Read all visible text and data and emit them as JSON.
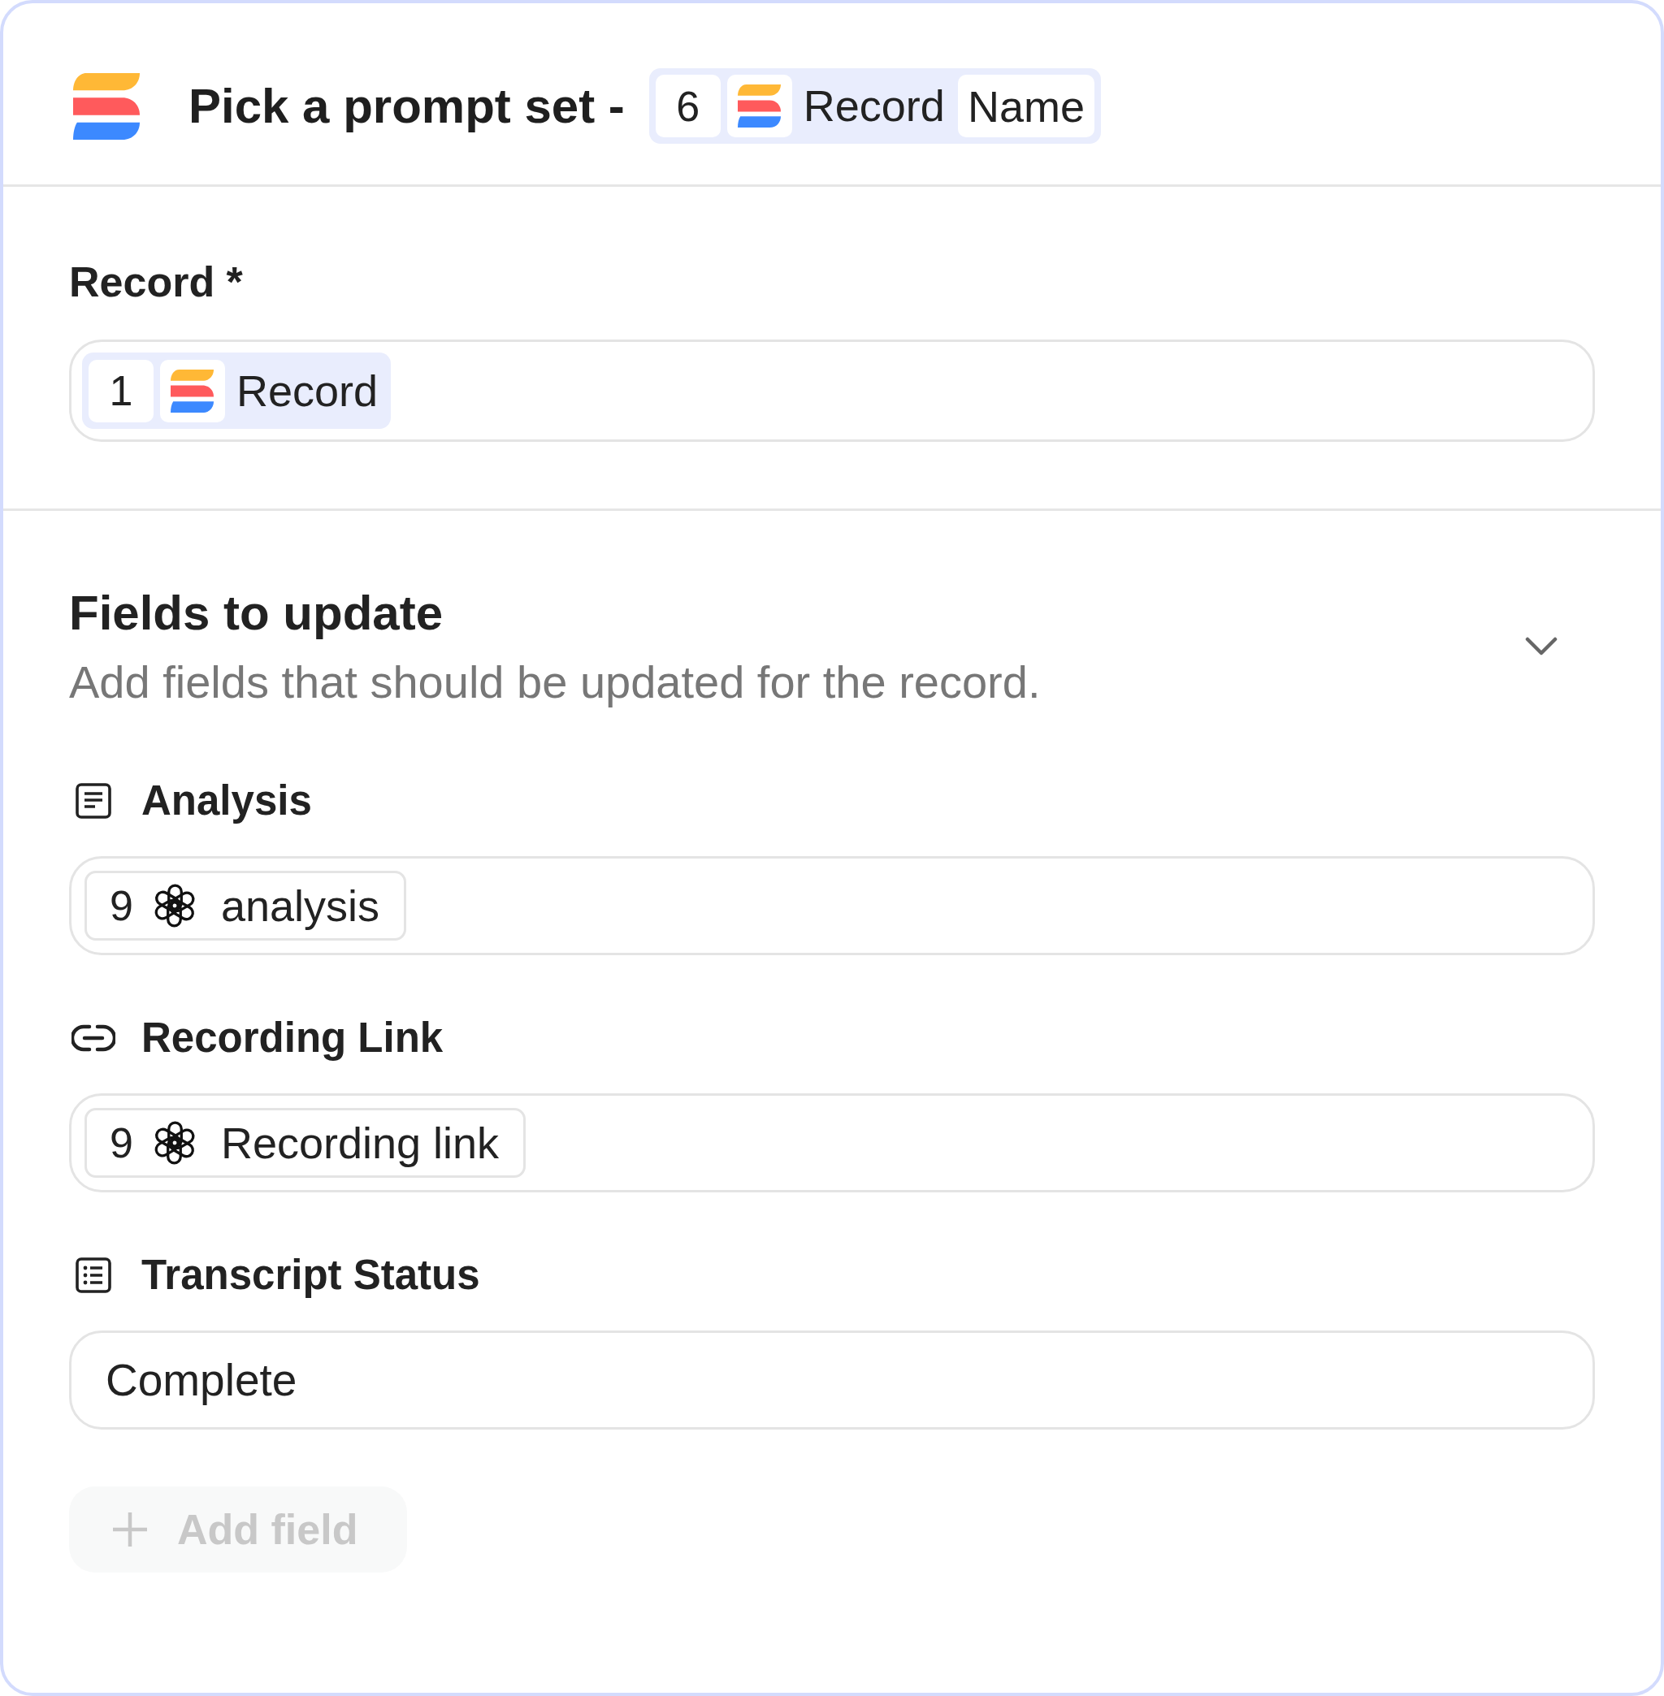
{
  "header": {
    "title": "Pick a prompt set -",
    "token": {
      "kind": "tinted",
      "step": "6",
      "label": "Record",
      "field": "Name"
    }
  },
  "record": {
    "label": "Record *",
    "token": {
      "kind": "tinted",
      "step": "1",
      "label": "Record"
    }
  },
  "fields_section": {
    "title": "Fields to update",
    "description": "Add fields that should be updated for the record.",
    "expanded": true
  },
  "fields": [
    {
      "kind": "text",
      "label": "Analysis",
      "value": {
        "kind": "outlined",
        "step": "9",
        "label": "analysis"
      }
    },
    {
      "kind": "link",
      "label": "Recording Link",
      "value": {
        "kind": "outlined",
        "step": "9",
        "label": "Recording link"
      }
    },
    {
      "kind": "select",
      "label": "Transcript Status",
      "value": {
        "kind": "plain",
        "label": "Complete"
      }
    }
  ],
  "add_field": {
    "label": "Add field",
    "disabled": true
  }
}
